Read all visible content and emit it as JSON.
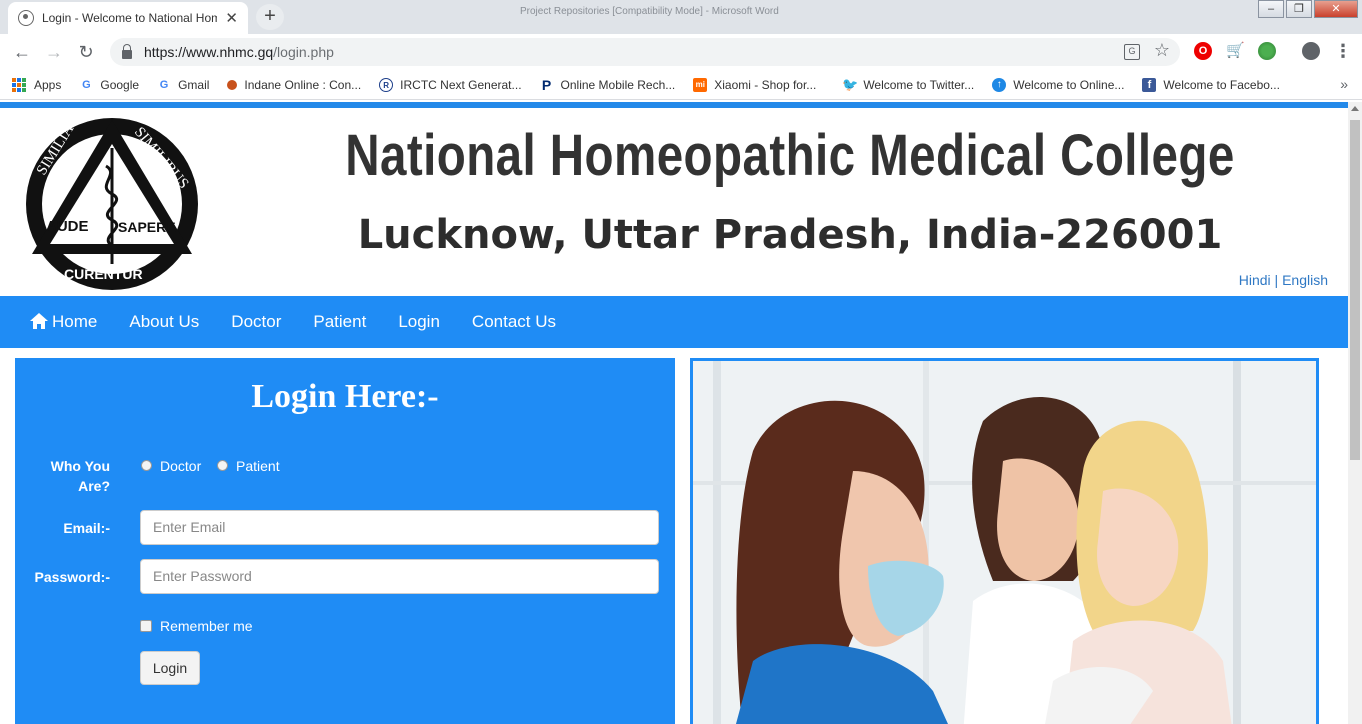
{
  "browser": {
    "tab_title": "Login - Welcome to National Homeopathic Medical College",
    "background_window_title": "Project Repositories [Compatibility Mode] - Microsoft Word",
    "url_domain": "https://www.nhmc.gq",
    "url_path": "/login.php",
    "bookmarks": [
      {
        "label": "Apps",
        "icon": "apps-grid-icon"
      },
      {
        "label": "Google",
        "icon": "google-icon"
      },
      {
        "label": "Gmail",
        "icon": "google-icon"
      },
      {
        "label": "Indane Online : Con...",
        "icon": "indane-icon"
      },
      {
        "label": "IRCTC Next Generat...",
        "icon": "irctc-icon"
      },
      {
        "label": "Online Mobile Rech...",
        "icon": "paytm-icon"
      },
      {
        "label": "Xiaomi - Shop for...",
        "icon": "mi-icon"
      },
      {
        "label": "Welcome to Twitter...",
        "icon": "twitter-icon"
      },
      {
        "label": "Welcome to Online...",
        "icon": "info-icon"
      },
      {
        "label": "Welcome to Facebo...",
        "icon": "facebook-icon"
      }
    ]
  },
  "header": {
    "logo_text_top_left": "SIMILIA",
    "logo_text_top_right": "SIMILIBUS",
    "logo_text_mid_left": "AUDE",
    "logo_text_mid_right": "SAPERE",
    "logo_text_bottom": "CURENTUR",
    "title": "National Homeopathic Medical College",
    "subtitle": "Lucknow, Uttar Pradesh, India-226001",
    "lang_hindi": "Hindi",
    "lang_sep": "|",
    "lang_english": "English"
  },
  "nav": {
    "home": "Home",
    "about": "About Us",
    "doctor": "Doctor",
    "patient": "Patient",
    "login": "Login",
    "contact": "Contact Us"
  },
  "login": {
    "title": "Login Here:-",
    "who_label": "Who You Are?",
    "who_label_line1": "Who You",
    "who_label_line2": "Are?",
    "option_doctor": "Doctor",
    "option_patient": "Patient",
    "email_label": "Email:-",
    "email_placeholder": "Enter Email",
    "password_label": "Password:-",
    "password_placeholder": "Enter Password",
    "remember": "Remember me",
    "button": "Login"
  },
  "colors": {
    "primary_blue": "#1f8cf5",
    "title_text": "#333333",
    "link_blue": "#2f78c4"
  }
}
